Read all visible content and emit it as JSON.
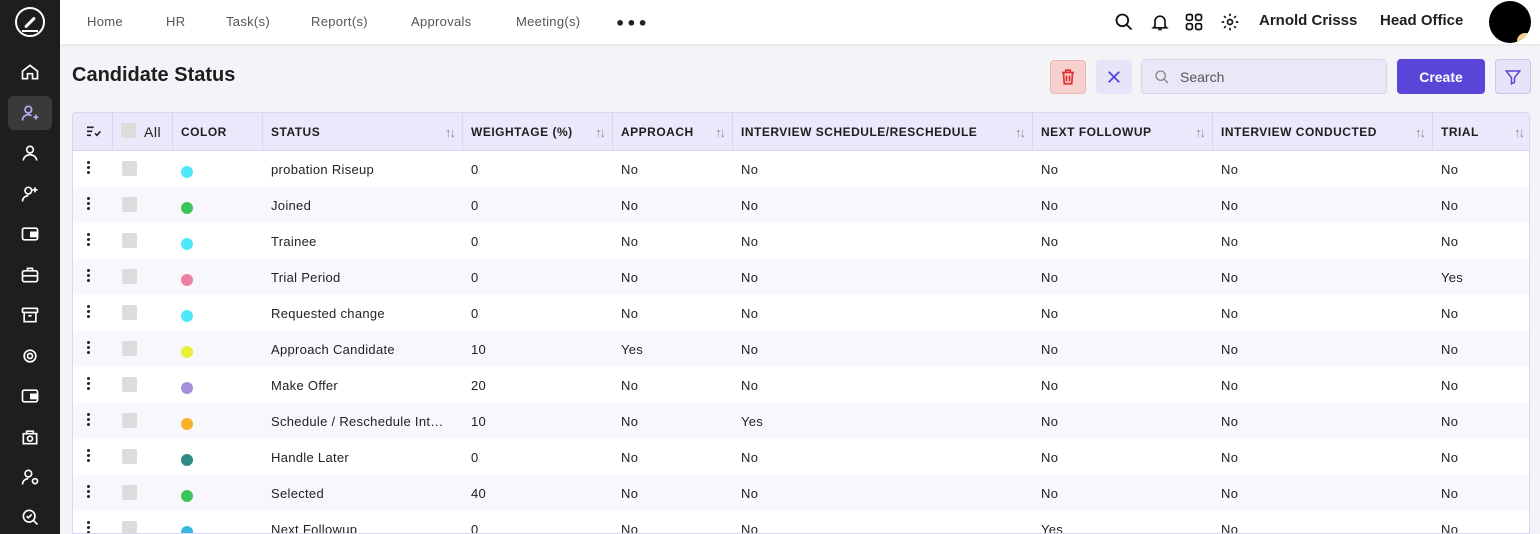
{
  "nav": {
    "items": [
      "Home",
      "HR",
      "Task(s)",
      "Report(s)",
      "Approvals",
      "Meeting(s)"
    ],
    "more": "•••"
  },
  "user": {
    "name": "Arnold Crisss",
    "company": "Head Office"
  },
  "page": {
    "title": "Candidate Status",
    "search_placeholder": "Search",
    "create_label": "Create",
    "select_all_label": "All"
  },
  "colors": {
    "accent": "#5946d8",
    "sidebar": "#1e1e1e",
    "header_bg": "#ebe8fc"
  },
  "table": {
    "columns": [
      "COLOR",
      "STATUS",
      "WEIGHTAGE (%)",
      "APPROACH",
      "INTERVIEW SCHEDULE/RESCHEDULE",
      "NEXT FOLLOWUP",
      "INTERVIEW CONDUCTED",
      "TRIAL"
    ],
    "rows": [
      {
        "color": "#4ee8f8",
        "status": "probation Riseup",
        "weightage": "0",
        "approach": "No",
        "interview_schedule": "No",
        "next_followup": "No",
        "interview_conducted": "No",
        "trial": "No"
      },
      {
        "color": "#3ec45a",
        "status": "Joined",
        "weightage": "0",
        "approach": "No",
        "interview_schedule": "No",
        "next_followup": "No",
        "interview_conducted": "No",
        "trial": "No"
      },
      {
        "color": "#4ee8f8",
        "status": "Trainee",
        "weightage": "0",
        "approach": "No",
        "interview_schedule": "No",
        "next_followup": "No",
        "interview_conducted": "No",
        "trial": "No"
      },
      {
        "color": "#f07ea0",
        "status": "Trial Period",
        "weightage": "0",
        "approach": "No",
        "interview_schedule": "No",
        "next_followup": "No",
        "interview_conducted": "No",
        "trial": "Yes"
      },
      {
        "color": "#4ee8f8",
        "status": "Requested change",
        "weightage": "0",
        "approach": "No",
        "interview_schedule": "No",
        "next_followup": "No",
        "interview_conducted": "No",
        "trial": "No"
      },
      {
        "color": "#e8f03a",
        "status": "Approach Candidate",
        "weightage": "10",
        "approach": "Yes",
        "interview_schedule": "No",
        "next_followup": "No",
        "interview_conducted": "No",
        "trial": "No"
      },
      {
        "color": "#a490de",
        "status": "Make Offer",
        "weightage": "20",
        "approach": "No",
        "interview_schedule": "No",
        "next_followup": "No",
        "interview_conducted": "No",
        "trial": "No"
      },
      {
        "color": "#f5b02e",
        "status": "Schedule / Reschedule Int…",
        "weightage": "10",
        "approach": "No",
        "interview_schedule": "Yes",
        "next_followup": "No",
        "interview_conducted": "No",
        "trial": "No"
      },
      {
        "color": "#2f8a86",
        "status": "Handle Later",
        "weightage": "0",
        "approach": "No",
        "interview_schedule": "No",
        "next_followup": "No",
        "interview_conducted": "No",
        "trial": "No"
      },
      {
        "color": "#3ec45a",
        "status": "Selected",
        "weightage": "40",
        "approach": "No",
        "interview_schedule": "No",
        "next_followup": "No",
        "interview_conducted": "No",
        "trial": "No"
      },
      {
        "color": "#3ab8e0",
        "status": "Next Followup",
        "weightage": "0",
        "approach": "No",
        "interview_schedule": "No",
        "next_followup": "Yes",
        "interview_conducted": "No",
        "trial": "No"
      }
    ]
  },
  "icons": {
    "sidebar": [
      "home-icon",
      "user-add-icon",
      "user-icon",
      "user-plus-icon",
      "wallet-icon",
      "briefcase-icon",
      "archive-icon",
      "badge-icon",
      "wallet-icon",
      "settings-box-icon",
      "user-gear-icon",
      "search-check-icon"
    ],
    "topbar": [
      "search-icon",
      "bell-icon",
      "grid-icon",
      "gear-icon"
    ]
  }
}
